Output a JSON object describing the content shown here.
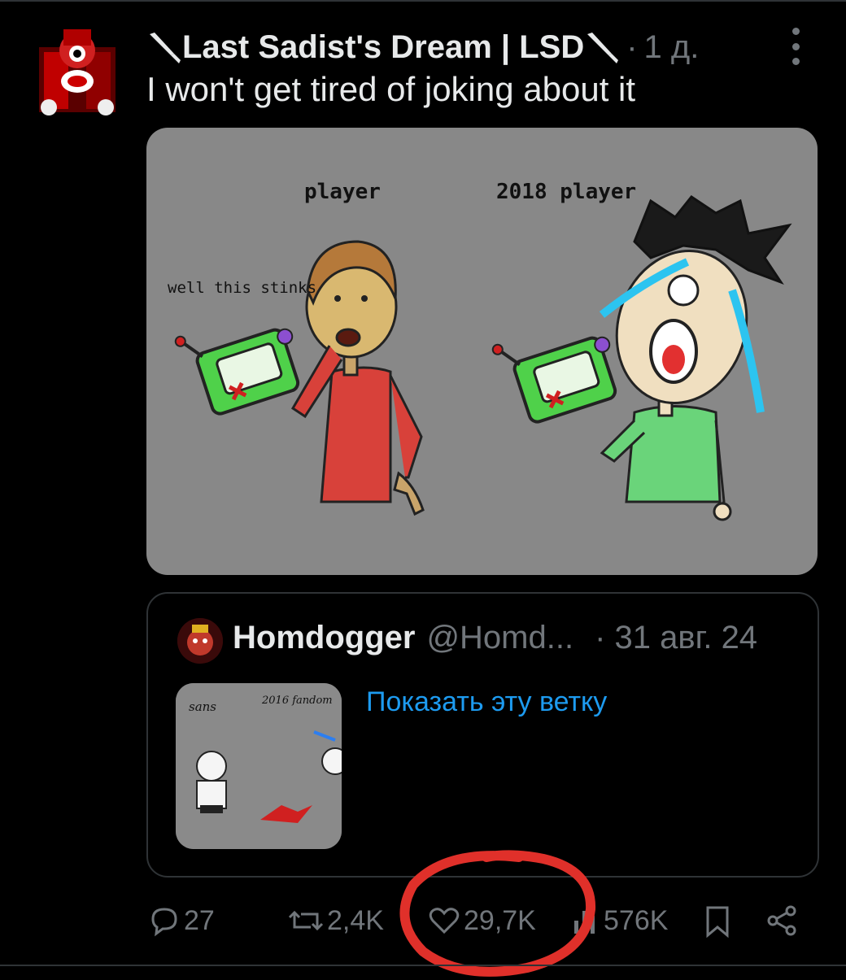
{
  "tweet": {
    "author_name": "Last Sadist's Dream | LSD",
    "separator": "·",
    "time": "1 д.",
    "text": "I won't get tired of joking about it"
  },
  "media": {
    "label_player": "player",
    "label_2018_player": "2018 player",
    "label_stinks": "well this stinks"
  },
  "quoted_tweet": {
    "name": "Homdogger",
    "handle": "@Homd...",
    "date": "· 31 авг. 24",
    "thumb_label_left": "sans",
    "thumb_label_right": "2016 fandom",
    "show_thread": "Показать эту ветку"
  },
  "actions": {
    "replies": "27",
    "reposts": "2,4K",
    "likes": "29,7K",
    "views": "576K"
  },
  "icons": {
    "author_decoration": "knife-icon",
    "reply": "reply-icon",
    "repost": "repost-icon",
    "like": "heart-icon",
    "views": "views-icon",
    "bookmark": "bookmark-icon",
    "share": "share-icon",
    "more": "more-icon"
  },
  "colors": {
    "background": "#000000",
    "text": "#e7e9ea",
    "secondary": "#71767b",
    "link": "#1d9bf0",
    "border": "#2f3336",
    "annotation": "#e0302a"
  }
}
